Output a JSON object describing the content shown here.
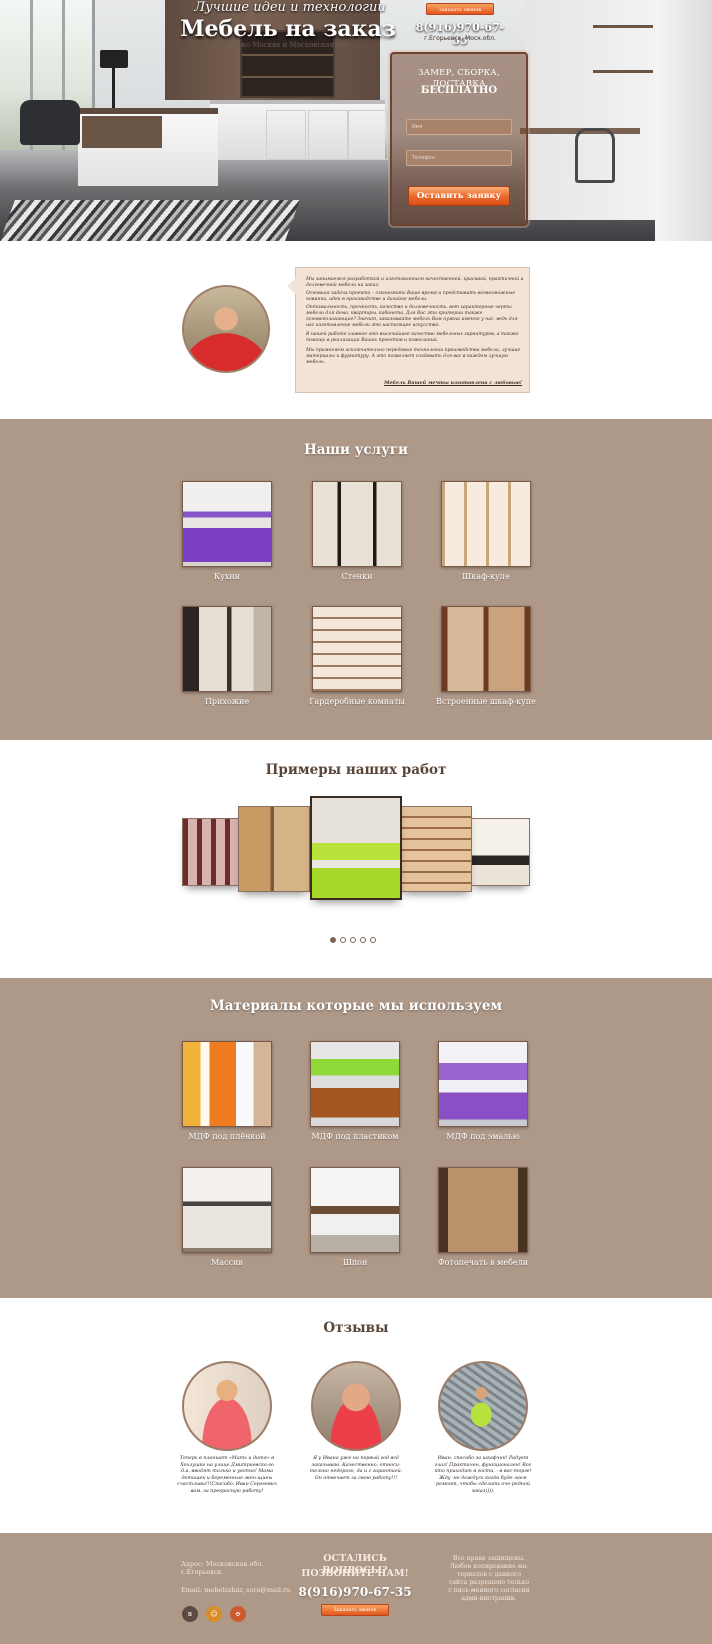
{
  "hero": {
    "tagline": "Лучшие идеи и технологии",
    "title": "Мебель на заказ",
    "subtitle": "Только Москва и Московская обл.",
    "callback_button": "Заказать звонок",
    "phone": "8(916)970-67-35",
    "city": "г.Егорьевск, Моск.обл.",
    "form": {
      "heading_line1": "ЗАМЕР, СБОРКА, ДОСТАВКА",
      "heading_line2": "БЕСПЛАТНО",
      "name_placeholder": "Имя",
      "phone_placeholder": "Телефон",
      "submit_label": "Оставить заявку"
    }
  },
  "about": {
    "paragraphs": [
      "Мы занимаемся разработкой и изготовлением качественной, красивой, практичной и долговечной мебели на заказ.",
      "Основная задача проекта – сэкономить Ваше время и представить всевозможные новинки, идеи в производстве и дизайне мебели.",
      "Оптимальность, прочность, качество и долговечность, вот характерные черты мебели для дома, квартиры, кабинета. Для Вас эти критерии также основополагающие? Значит, заказывайте мебель Вам нужна именно у нас, ведь для нас изготовление мебели это настоящее искусство.",
      "В нашей работе главное это высочайшее качество мебельных гарнитуров, а также помощь в реализации Ваших проектов и пожеланий.",
      "Мы применяем исключительно передовые технологии производства мебели, лучшие материалы и фурнитуру. А это позволяет создавать для вас в каждом лучшую мебель."
    ],
    "signature": "Мебель Вашей мечты изготовлена с любовью!"
  },
  "services": {
    "title": "Наши услуги",
    "items": [
      {
        "label": "Кухни",
        "picture": "purple-kitchen"
      },
      {
        "label": "Стенки",
        "picture": "wall-unit"
      },
      {
        "label": "Шкаф-купе",
        "picture": "glass-wardrobe"
      },
      {
        "label": "Прихожие",
        "picture": "hallway"
      },
      {
        "label": "Гардеробные комнаты",
        "picture": "dressing-room"
      },
      {
        "label": "Встроенные шкаф-купе",
        "picture": "built-in-wardrobe"
      }
    ]
  },
  "portfolio": {
    "title": "Примеры наших работ",
    "slides": [
      "wardrobe-pattern",
      "wardrobe-wood",
      "green-kitchen",
      "dressing-room",
      "white-kitchen"
    ],
    "active_dot": 1,
    "dots_count": 5
  },
  "materials": {
    "title": "Материалы которые мы используем",
    "items": [
      {
        "label": "МДФ под плёнкой",
        "picture": "orange-furniture"
      },
      {
        "label": "МДФ под пластиком",
        "picture": "green-kitchen"
      },
      {
        "label": "МДФ под эмалью",
        "picture": "purple-kitchen"
      },
      {
        "label": "Массив",
        "picture": "white-kitchen"
      },
      {
        "label": "Шпон",
        "picture": "veneer-kitchen"
      },
      {
        "label": "Фотопечать в мебели",
        "picture": "photo-print-bedroom"
      }
    ]
  },
  "reviews": {
    "title": "Отзывы",
    "items": [
      {
        "text": "Теперь в планшет «Мать и дитя» в Хохлушке на улице Дмитриевско-го д.а. вводят только и уютно! Мама детишек и беременные жен-щины счастливы!!!Спасибо, Иван Сергеевич вам, за прекрасную работу!"
      },
      {
        "text": "Я у Ивана уже на первый год всё заказываю. Качественно, относи-тельно недорого, да и с гарантией. Он отвечает за свою работу!!!"
      },
      {
        "text": "Иван, спасибо за шкафчик! Радует глаз! Практичен, функционален! Все кто приходит в гости, - в вос-торге! Жду -не дождусь когда буде-лаем ремонт, чтобы сделать оче-редной заказ))))."
      }
    ]
  },
  "footer": {
    "address_line1": "Адрес: Московская обл.",
    "address_line2": "г.Егорьевск",
    "email": "Email: mebelzakaz_sora@mail.ru",
    "question_line1": "ОСТАЛИСЬ ВОПРОСЫ?",
    "question_line2": "ПОЗВОНИТЕ НАМ!",
    "phone": "8(916)970-67-35",
    "callback_button": "Заказать звонок",
    "rights": "Все права защищены. Любое копирование ма-териалов с данного сайта разрешено только с пись-менного согласия адми-нистрации.",
    "social": [
      {
        "icon": "vk-icon",
        "glyph": "в",
        "color": "#4a76a8"
      },
      {
        "icon": "odnoklassniki-icon",
        "glyph": "☺",
        "color": "#d98c2b"
      },
      {
        "icon": "ok-icon",
        "glyph": "ꝋ",
        "color": "#cc5a2e"
      }
    ]
  },
  "colors": {
    "section_brown": "#ae9888",
    "accent_orange": "#e2561f",
    "about_card": "#f2e3d6"
  }
}
